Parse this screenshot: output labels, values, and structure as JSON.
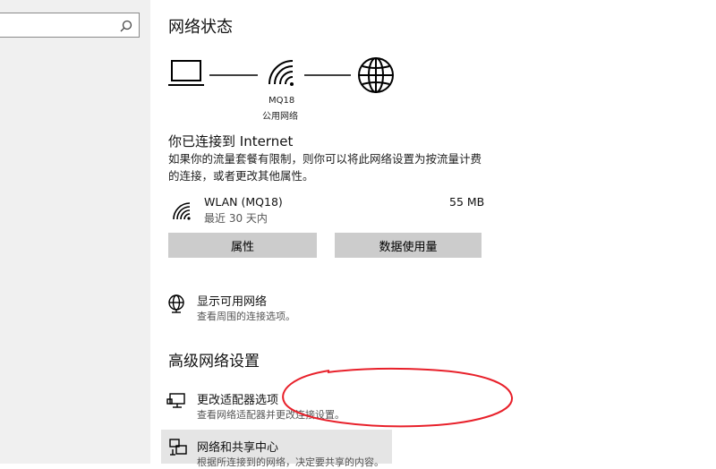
{
  "sidebar": {
    "search_placeholder": ""
  },
  "status": {
    "title": "网络状态",
    "network_name": "MQ18",
    "network_type": "公用网络",
    "connected_title": "你已连接到 Internet",
    "connected_desc": "如果你的流量套餐有限制，则你可以将此网络设置为按流量计费的连接，或者更改其他属性。"
  },
  "connection": {
    "name": "WLAN (MQ18)",
    "period": "最近 30 天内",
    "usage": "55 MB"
  },
  "buttons": {
    "properties": "属性",
    "data_usage": "数据使用量"
  },
  "show_networks": {
    "title": "显示可用网络",
    "subtitle": "查看周围的连接选项。"
  },
  "advanced": {
    "title": "高级网络设置",
    "adapter": {
      "title": "更改适配器选项",
      "subtitle": "查看网络适配器并更改连接设置。"
    },
    "sharing_center": {
      "title": "网络和共享中心",
      "subtitle": "根据所连接到的网络，决定要共享的内容。"
    }
  },
  "annotation_color": "#e8202a"
}
